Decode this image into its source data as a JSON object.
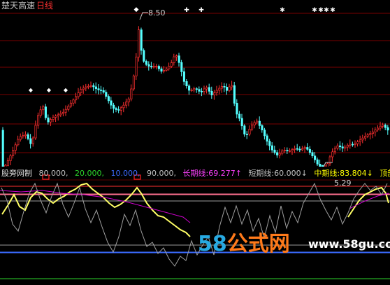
{
  "header": {
    "title": "楚天高速",
    "period": "日线"
  },
  "price_labels": {
    "high": "8.50",
    "low": "5.29"
  },
  "indicator": {
    "name": "股旁网制",
    "levels": [
      {
        "text": "80.000,",
        "color": "#c0c0c0"
      },
      {
        "text": "20.000,",
        "color": "#2bd42b"
      },
      {
        "text": "10.000,",
        "color": "#3b6bff"
      },
      {
        "text": "90.000,",
        "color": "#c0c0c0"
      }
    ],
    "long": {
      "label": "长期线:",
      "value": "69.277↑",
      "color": "#ff40ff"
    },
    "short": {
      "label": "短期线:",
      "value": "60.000↓",
      "color": "#c0c0c0"
    },
    "mid": {
      "label": "中期线:",
      "value": "83.804↓",
      "color": "#ffff00"
    },
    "tail": {
      "label": "顶部",
      "color": "#ffff00"
    }
  },
  "watermark": {
    "brand_num": "58",
    "brand_cn": "公式网",
    "url": "www.58gu.com"
  },
  "colors": {
    "up": "#ff3030",
    "down": "#54ffff",
    "grid": "#7a0000",
    "mid": "#ffff66",
    "long": "#cc00cc",
    "short": "#a0a0a0"
  }
}
